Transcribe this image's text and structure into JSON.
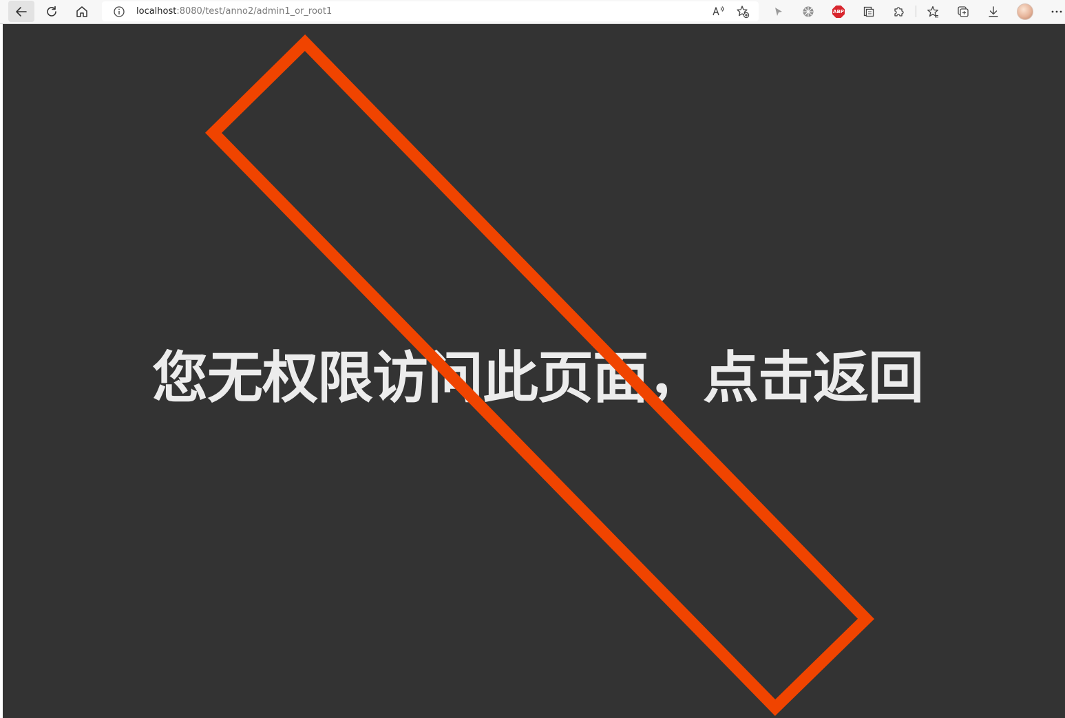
{
  "browser": {
    "url_host": "localhost",
    "url_rest": ":8080/test/anno2/admin1_or_root1",
    "abp_label": "ABP",
    "icons": {
      "back": "back-arrow-icon",
      "refresh": "refresh-icon",
      "home": "home-icon",
      "site_info": "info-icon",
      "read_aloud": "read-aloud-icon",
      "add_favorite": "add-favorite-icon",
      "extensions": [
        "cursor-extension-icon",
        "grid-extension-icon",
        "adblock-plus-icon",
        "collections-extension-icon",
        "puzzle-extensions-icon"
      ],
      "favorites": "favorites-star-icon",
      "collections": "collections-icon",
      "downloads": "download-icon",
      "profile": "avatar",
      "menu": "more-menu-icon"
    }
  },
  "page": {
    "background_color": "#333333",
    "message": "您无权限访问此页面，点击返回",
    "overlay_stroke_color": "#f04400"
  }
}
